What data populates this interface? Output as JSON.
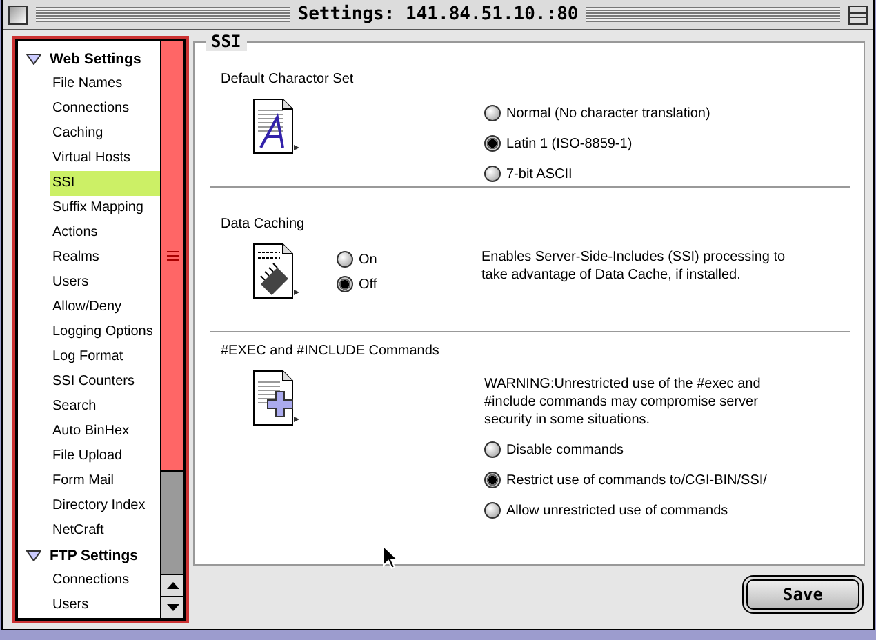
{
  "window": {
    "title": "Settings: 141.84.51.10.:80"
  },
  "sidebar": {
    "groups": [
      {
        "label": "Web Settings",
        "expanded": true,
        "children": [
          {
            "label": "File Names",
            "selected": false
          },
          {
            "label": "Connections",
            "selected": false
          },
          {
            "label": "Caching",
            "selected": false
          },
          {
            "label": "Virtual Hosts",
            "selected": false
          },
          {
            "label": "SSI",
            "selected": true
          },
          {
            "label": "Suffix Mapping",
            "selected": false
          },
          {
            "label": "Actions",
            "selected": false
          },
          {
            "label": "Realms",
            "selected": false
          },
          {
            "label": "Users",
            "selected": false
          },
          {
            "label": "Allow/Deny",
            "selected": false
          },
          {
            "label": "Logging Options",
            "selected": false
          },
          {
            "label": "Log Format",
            "selected": false
          },
          {
            "label": "SSI Counters",
            "selected": false
          },
          {
            "label": "Search",
            "selected": false
          },
          {
            "label": "Auto BinHex",
            "selected": false
          },
          {
            "label": "File Upload",
            "selected": false
          },
          {
            "label": "Form Mail",
            "selected": false
          },
          {
            "label": "Directory Index",
            "selected": false
          },
          {
            "label": "NetCraft",
            "selected": false
          }
        ]
      },
      {
        "label": "FTP Settings",
        "expanded": true,
        "children": [
          {
            "label": "Connections",
            "selected": false
          },
          {
            "label": "Users",
            "selected": false
          }
        ]
      }
    ]
  },
  "panel": {
    "title": "SSI",
    "sections": [
      {
        "title": "Default Charactor Set",
        "kind": "stacked",
        "options": [
          {
            "label": "Normal (No character translation)",
            "selected": false
          },
          {
            "label": "Latin 1 (ISO-8859-1)",
            "selected": true
          },
          {
            "label": "7-bit ASCII",
            "selected": false
          }
        ]
      },
      {
        "title": "Data Caching",
        "kind": "side",
        "description": "Enables Server-Side-Includes (SSI) processing to take advantage of Data Cache, if installed.",
        "options": [
          {
            "label": "On",
            "selected": false
          },
          {
            "label": "Off",
            "selected": true
          }
        ]
      },
      {
        "title": "#EXEC and #INCLUDE Commands",
        "kind": "stacked",
        "description": "WARNING:Unrestricted use of the #exec and #include commands may compromise server security in some situations.",
        "options": [
          {
            "label": "Disable commands",
            "selected": false
          },
          {
            "label": "Restrict use of commands to/CGI-BIN/SSI/",
            "selected": true
          },
          {
            "label": "Allow unrestricted use of commands",
            "selected": false
          }
        ]
      }
    ]
  },
  "buttons": [
    {
      "label": "Save",
      "default": true
    }
  ]
}
